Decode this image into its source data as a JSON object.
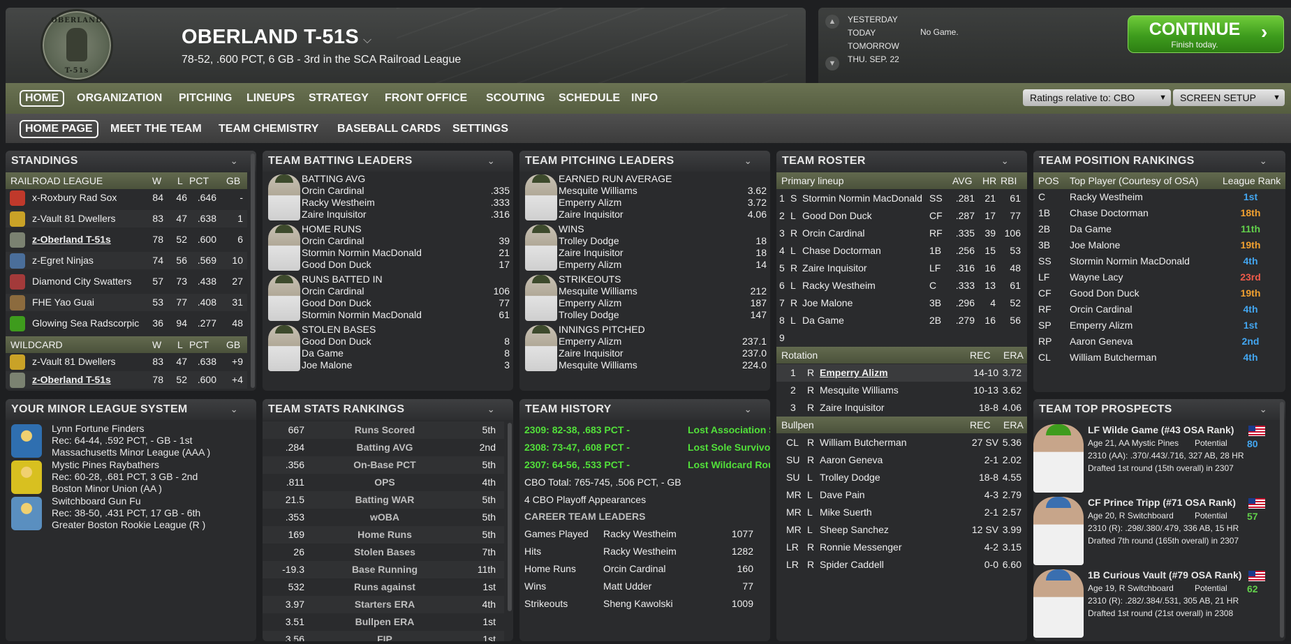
{
  "header": {
    "team_name": "OBERLAND T-51S",
    "record": "78-52, .600 PCT, 6 GB - 3rd in the SCA Railroad League",
    "logo_top": "OBERLAND",
    "logo_bottom": "T-51s"
  },
  "date": {
    "days": [
      "YESTERDAY",
      "TODAY",
      "TOMORROW",
      "THU. SEP. 22"
    ],
    "status": "No Game.",
    "continue_label": "CONTINUE",
    "continue_sub": "Finish today."
  },
  "nav": {
    "items": [
      "HOME",
      "ORGANIZATION",
      "PITCHING",
      "LINEUPS",
      "STRATEGY",
      "FRONT OFFICE",
      "SCOUTING",
      "SCHEDULE",
      "INFO"
    ],
    "ratings_select": "Ratings relative to: CBO",
    "screen_setup": "SCREEN SETUP"
  },
  "subnav": {
    "items": [
      "HOME PAGE",
      "MEET THE TEAM",
      "TEAM CHEMISTRY",
      "BASEBALL CARDS",
      "SETTINGS"
    ]
  },
  "standings": {
    "title": "STANDINGS",
    "league_header": [
      "RAILROAD LEAGUE",
      "W",
      "L",
      "PCT",
      "GB"
    ],
    "rows": [
      {
        "team": "x-Roxbury Rad Sox",
        "w": "84",
        "l": "46",
        "pct": ".646",
        "gb": "-"
      },
      {
        "team": "z-Vault 81 Dwellers",
        "w": "83",
        "l": "47",
        "pct": ".638",
        "gb": "1"
      },
      {
        "team": "z-Oberland T-51s",
        "w": "78",
        "l": "52",
        "pct": ".600",
        "gb": "6"
      },
      {
        "team": "z-Egret Ninjas",
        "w": "74",
        "l": "56",
        "pct": ".569",
        "gb": "10"
      },
      {
        "team": "Diamond City Swatters",
        "w": "57",
        "l": "73",
        "pct": ".438",
        "gb": "27"
      },
      {
        "team": "FHE Yao Guai",
        "w": "53",
        "l": "77",
        "pct": ".408",
        "gb": "31"
      },
      {
        "team": "Glowing Sea Radscorpic",
        "w": "36",
        "l": "94",
        "pct": ".277",
        "gb": "48"
      }
    ],
    "wildcard_header": [
      "WILDCARD",
      "W",
      "L",
      "PCT",
      "GB"
    ],
    "wildcard_rows": [
      {
        "team": "z-Vault 81 Dwellers",
        "w": "83",
        "l": "47",
        "pct": ".638",
        "gb": "+9"
      },
      {
        "team": "z-Oberland T-51s",
        "w": "78",
        "l": "52",
        "pct": ".600",
        "gb": "+4"
      }
    ]
  },
  "batting": {
    "title": "TEAM BATTING LEADERS",
    "blocks": [
      {
        "stat": "BATTING AVG",
        "rows": [
          [
            "Orcin Cardinal",
            ".335"
          ],
          [
            "Racky Westheim",
            ".333"
          ],
          [
            "Zaire Inquisitor",
            ".316"
          ]
        ]
      },
      {
        "stat": "HOME RUNS",
        "rows": [
          [
            "Orcin Cardinal",
            "39"
          ],
          [
            "Stormin Normin MacDonald",
            "21"
          ],
          [
            "Good Don Duck",
            "17"
          ]
        ]
      },
      {
        "stat": "RUNS BATTED IN",
        "rows": [
          [
            "Orcin Cardinal",
            "106"
          ],
          [
            "Good Don Duck",
            "77"
          ],
          [
            "Stormin Normin MacDonald",
            "61"
          ]
        ]
      },
      {
        "stat": "STOLEN BASES",
        "rows": [
          [
            "Good Don Duck",
            "8"
          ],
          [
            "Da Game",
            "8"
          ],
          [
            "Joe Malone",
            "3"
          ]
        ]
      }
    ]
  },
  "pitching": {
    "title": "TEAM PITCHING LEADERS",
    "blocks": [
      {
        "stat": "EARNED RUN AVERAGE",
        "rows": [
          [
            "Mesquite Williams",
            "3.62"
          ],
          [
            "Emperry Alizm",
            "3.72"
          ],
          [
            "Zaire Inquisitor",
            "4.06"
          ]
        ]
      },
      {
        "stat": "WINS",
        "rows": [
          [
            "Trolley Dodge",
            "18"
          ],
          [
            "Zaire Inquisitor",
            "18"
          ],
          [
            "Emperry Alizm",
            "14"
          ]
        ]
      },
      {
        "stat": "STRIKEOUTS",
        "rows": [
          [
            "Mesquite Williams",
            "212"
          ],
          [
            "Emperry Alizm",
            "187"
          ],
          [
            "Trolley Dodge",
            "147"
          ]
        ]
      },
      {
        "stat": "INNINGS PITCHED",
        "rows": [
          [
            "Emperry Alizm",
            "237.1"
          ],
          [
            "Zaire Inquisitor",
            "237.0"
          ],
          [
            "Mesquite Williams",
            "224.0"
          ]
        ]
      }
    ]
  },
  "roster": {
    "title": "TEAM ROSTER",
    "lineup_header": [
      "Primary lineup",
      "AVG",
      "HR",
      "RBI"
    ],
    "lineup": [
      {
        "n": "1",
        "h": "S",
        "name": "Stormin Normin MacDonald",
        "pos": "SS",
        "avg": ".281",
        "hr": "21",
        "rbi": "61"
      },
      {
        "n": "2",
        "h": "L",
        "name": "Good Don Duck",
        "pos": "CF",
        "avg": ".287",
        "hr": "17",
        "rbi": "77"
      },
      {
        "n": "3",
        "h": "R",
        "name": "Orcin Cardinal",
        "pos": "RF",
        "avg": ".335",
        "hr": "39",
        "rbi": "106"
      },
      {
        "n": "4",
        "h": "L",
        "name": "Chase Doctorman",
        "pos": "1B",
        "avg": ".256",
        "hr": "15",
        "rbi": "53"
      },
      {
        "n": "5",
        "h": "R",
        "name": "Zaire Inquisitor",
        "pos": "LF",
        "avg": ".316",
        "hr": "16",
        "rbi": "48"
      },
      {
        "n": "6",
        "h": "L",
        "name": "Racky Westheim",
        "pos": "C",
        "avg": ".333",
        "hr": "13",
        "rbi": "61"
      },
      {
        "n": "7",
        "h": "R",
        "name": "Joe Malone",
        "pos": "3B",
        "avg": ".296",
        "hr": "4",
        "rbi": "52"
      },
      {
        "n": "8",
        "h": "L",
        "name": "Da Game",
        "pos": "2B",
        "avg": ".279",
        "hr": "16",
        "rbi": "56"
      },
      {
        "n": "9",
        "h": "",
        "name": "",
        "pos": "",
        "avg": "",
        "hr": "",
        "rbi": ""
      }
    ],
    "rotation_header": [
      "Rotation",
      "REC",
      "ERA"
    ],
    "rotation": [
      {
        "n": "1",
        "h": "R",
        "name": "Emperry Alizm",
        "rec": "14-10",
        "era": "3.72"
      },
      {
        "n": "2",
        "h": "R",
        "name": "Mesquite Williams",
        "rec": "10-13",
        "era": "3.62"
      },
      {
        "n": "3",
        "h": "R",
        "name": "Zaire Inquisitor",
        "rec": "18-8",
        "era": "4.06"
      }
    ],
    "bullpen_header": [
      "Bullpen",
      "REC",
      "ERA"
    ],
    "bullpen": [
      {
        "role": "CL",
        "h": "R",
        "name": "William Butcherman",
        "rec": "27 SV",
        "era": "5.36"
      },
      {
        "role": "SU",
        "h": "R",
        "name": "Aaron Geneva",
        "rec": "2-1",
        "era": "2.02"
      },
      {
        "role": "SU",
        "h": "L",
        "name": "Trolley Dodge",
        "rec": "18-8",
        "era": "4.55"
      },
      {
        "role": "MR",
        "h": "L",
        "name": "Dave Pain",
        "rec": "4-3",
        "era": "2.79"
      },
      {
        "role": "MR",
        "h": "L",
        "name": "Mike Suerth",
        "rec": "2-1",
        "era": "2.57"
      },
      {
        "role": "MR",
        "h": "L",
        "name": "Sheep Sanchez",
        "rec": "12 SV",
        "era": "3.99"
      },
      {
        "role": "LR",
        "h": "R",
        "name": "Ronnie Messenger",
        "rec": "4-2",
        "era": "3.15"
      },
      {
        "role": "LR",
        "h": "R",
        "name": "Spider Caddell",
        "rec": "0-0",
        "era": "6.60"
      }
    ]
  },
  "positions": {
    "title": "TEAM POSITION RANKINGS",
    "header": [
      "POS",
      "Top Player (Courtesy of OSA)",
      "League Rank"
    ],
    "rows": [
      {
        "pos": "C",
        "player": "Racky Westheim",
        "rank": "1st",
        "color": "#43a6f0"
      },
      {
        "pos": "1B",
        "player": "Chase Doctorman",
        "rank": "18th",
        "color": "#f0a030"
      },
      {
        "pos": "2B",
        "player": "Da Game",
        "rank": "11th",
        "color": "#62d04b"
      },
      {
        "pos": "3B",
        "player": "Joe Malone",
        "rank": "19th",
        "color": "#f0a030"
      },
      {
        "pos": "SS",
        "player": "Stormin Normin MacDonald",
        "rank": "4th",
        "color": "#43a6f0"
      },
      {
        "pos": "LF",
        "player": "Wayne Lacy",
        "rank": "23rd",
        "color": "#ef5a4a"
      },
      {
        "pos": "CF",
        "player": "Good Don Duck",
        "rank": "19th",
        "color": "#f0a030"
      },
      {
        "pos": "RF",
        "player": "Orcin Cardinal",
        "rank": "4th",
        "color": "#43a6f0"
      },
      {
        "pos": "SP",
        "player": "Emperry Alizm",
        "rank": "1st",
        "color": "#43a6f0"
      },
      {
        "pos": "RP",
        "player": "Aaron Geneva",
        "rank": "2nd",
        "color": "#43a6f0"
      },
      {
        "pos": "CL",
        "player": "William Butcherman",
        "rank": "4th",
        "color": "#43a6f0"
      }
    ]
  },
  "minor": {
    "title": "YOUR MINOR LEAGUE SYSTEM",
    "teams": [
      {
        "name": "Lynn Fortune Finders",
        "rec": "Rec: 64-44, .592 PCT, - GB - 1st",
        "league": "Massachusetts Minor League (AAA )"
      },
      {
        "name": "Mystic Pines Raybathers",
        "rec": "Rec: 60-28, .681 PCT, 3 GB - 2nd",
        "league": "Boston Minor Union (AA )"
      },
      {
        "name": "Switchboard Gun Fu",
        "rec": "Rec: 38-50, .431 PCT, 17 GB - 6th",
        "league": "Greater Boston Rookie League (R )"
      }
    ]
  },
  "stats": {
    "title": "TEAM STATS RANKINGS",
    "rows": [
      [
        "667",
        "Runs Scored",
        "5th"
      ],
      [
        ".284",
        "Batting AVG",
        "2nd"
      ],
      [
        ".356",
        "On-Base PCT",
        "5th"
      ],
      [
        ".811",
        "OPS",
        "4th"
      ],
      [
        "21.5",
        "Batting WAR",
        "5th"
      ],
      [
        ".353",
        "wOBA",
        "5th"
      ],
      [
        "169",
        "Home Runs",
        "5th"
      ],
      [
        "26",
        "Stolen Bases",
        "7th"
      ],
      [
        "-19.3",
        "Base Running",
        "11th"
      ],
      [
        "532",
        "Runs against",
        "1st"
      ],
      [
        "3.97",
        "Starters ERA",
        "4th"
      ],
      [
        "3.51",
        "Bullpen ERA",
        "1st"
      ],
      [
        "3.56",
        "FIP",
        "1st"
      ]
    ]
  },
  "history": {
    "title": "TEAM HISTORY",
    "seasons": [
      [
        "2309: 82-38, .683 PCT -",
        "Lost Association S"
      ],
      [
        "2308: 73-47, .608 PCT -",
        "Lost Sole Survivo"
      ],
      [
        "2307: 64-56, .533 PCT -",
        "Lost Wildcard Rou"
      ]
    ],
    "total": "CBO Total: 765-745, .506 PCT, - GB",
    "playoffs": "4 CBO Playoff Appearances",
    "leaders_header": "CAREER TEAM LEADERS",
    "leaders": [
      [
        "Games Played",
        "Racky Westheim",
        "1077"
      ],
      [
        "Hits",
        "Racky Westheim",
        "1282"
      ],
      [
        "Home Runs",
        "Orcin Cardinal",
        "160"
      ],
      [
        "Wins",
        "Matt Udder",
        "77"
      ],
      [
        "Strikeouts",
        "Sheng Kawolski",
        "1009"
      ]
    ]
  },
  "prospects": {
    "title": "TEAM TOP PROSPECTS",
    "items": [
      {
        "name": "LF Wilde Game (#43 OSA Rank)",
        "info": "Age 21, AA Mystic Pines",
        "pot_label": "Potential",
        "pot": "80",
        "pot_color": "#43a6f0",
        "stats": "2310 (AA): .370/.443/.716, 327 AB, 28 HR",
        "draft": "Drafted 1st round (15th overall) in 2307"
      },
      {
        "name": "CF Prince Tripp (#71 OSA Rank)",
        "info": "Age 20, R Switchboard",
        "pot_label": "Potential",
        "pot": "57",
        "pot_color": "#62d04b",
        "stats": "2310 (R): .298/.380/.479, 336 AB, 15 HR",
        "draft": "Drafted 7th round (165th overall) in 2307"
      },
      {
        "name": "1B Curious Vault (#79 OSA Rank)",
        "info": "Age 19, R Switchboard",
        "pot_label": "Potential",
        "pot": "62",
        "pot_color": "#62d04b",
        "stats": "2310 (R): .282/.384/.531, 305 AB, 21 HR",
        "draft": "Drafted 1st round (21st overall) in 2308"
      }
    ]
  },
  "colors": {
    "nav_green": "#5e6648",
    "continue_green": "#4aaa22",
    "rank_blue": "#43a6f0",
    "rank_orange": "#f0a030",
    "rank_red": "#ef5a4a",
    "history_green": "#52e03a"
  }
}
